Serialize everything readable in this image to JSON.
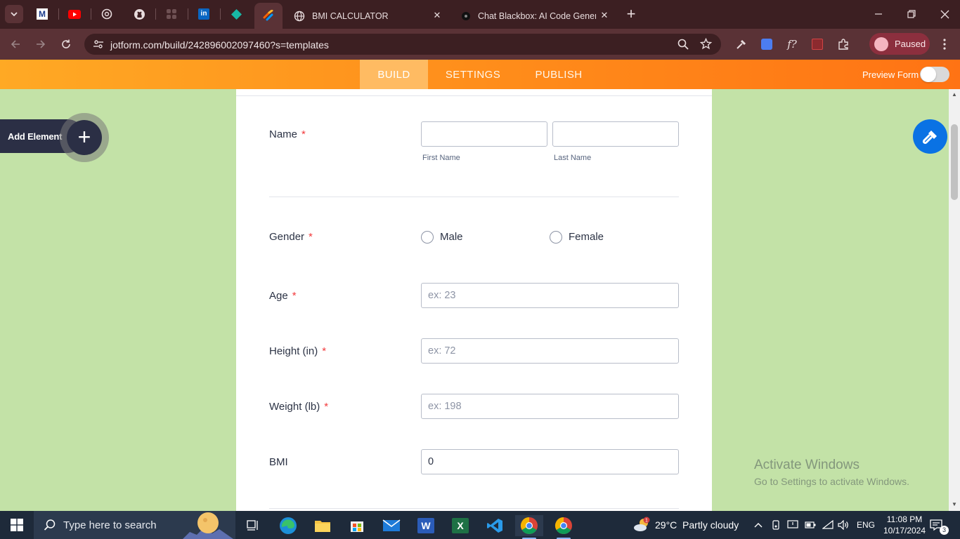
{
  "browser": {
    "tabs": [
      {
        "title": "BMI CALCULATOR",
        "icon": "globe-icon"
      },
      {
        "title": "Chat Blackbox: AI Code Generat",
        "icon": "blackbox-icon"
      }
    ],
    "close_glyph": "✕",
    "new_tab_glyph": "+",
    "url": "jotform.com/build/242896002097460?s=templates",
    "profile_status": "Paused"
  },
  "jotform": {
    "tabs": [
      "BUILD",
      "SETTINGS",
      "PUBLISH"
    ],
    "active_tab": "BUILD",
    "preview_form_label": "Preview Form",
    "preview_enabled": false,
    "add_element_label": "Add Element",
    "add_glyph": "+"
  },
  "form": {
    "required_mark": "*",
    "name": {
      "label": "Name",
      "first_sublabel": "First Name",
      "last_sublabel": "Last Name",
      "first_value": "",
      "last_value": ""
    },
    "gender": {
      "label": "Gender",
      "options": [
        "Male",
        "Female"
      ]
    },
    "age": {
      "label": "Age",
      "placeholder": "ex: 23"
    },
    "height": {
      "label": "Height (in)",
      "placeholder": "ex: 72"
    },
    "weight": {
      "label": "Weight (lb)",
      "placeholder": "ex: 198"
    },
    "bmi": {
      "label": "BMI",
      "value": "0"
    }
  },
  "watermark": {
    "line1": "Activate Windows",
    "line2": "Go to Settings to activate Windows."
  },
  "taskbar": {
    "search_placeholder": "Type here to search",
    "weather": "29°C  Partly cloudy",
    "weather_badge": "1",
    "language": "ENG",
    "time": "11:08 PM",
    "date": "10/17/2024",
    "notifications": "3"
  },
  "colors": {
    "accent_orange": "#ff8b1a",
    "canvas_green": "#c3e2a7",
    "designer_blue": "#0a72e4",
    "required_red": "#f23a3c"
  }
}
